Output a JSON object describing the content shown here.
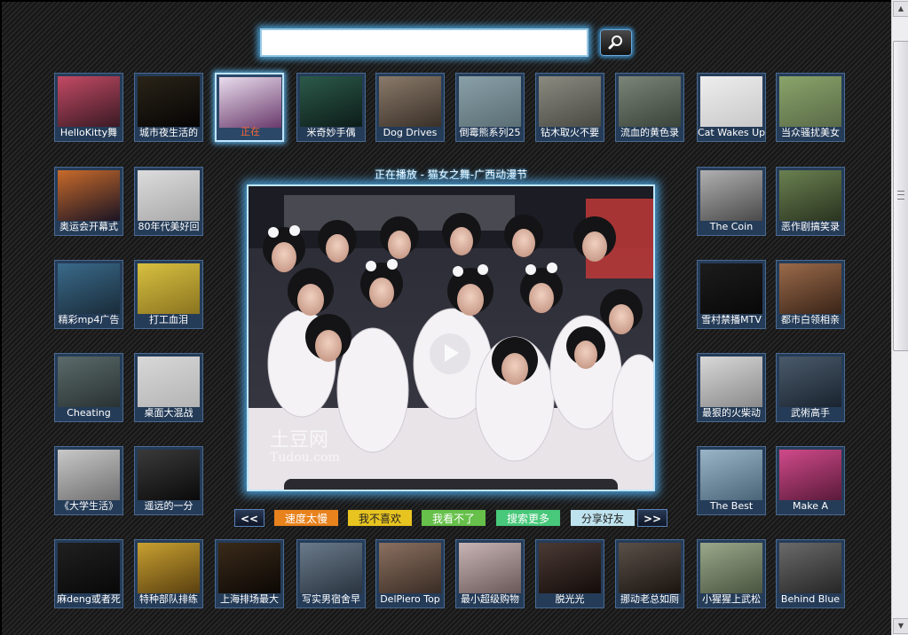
{
  "search": {
    "placeholder": "",
    "value": "",
    "button_icon": "magnifier-icon"
  },
  "player": {
    "now_playing": "正在播放 - 猫女之舞-广西动漫节",
    "watermark_line1": "土豆网",
    "watermark_line2": "Tudou.com"
  },
  "controls": {
    "prev": "<<",
    "next": ">>",
    "buttons": [
      {
        "label": "速度太慢",
        "bg": "#e8821c",
        "fg": "#ffffff"
      },
      {
        "label": "我不喜欢",
        "bg": "#e8c420",
        "fg": "#222222"
      },
      {
        "label": "我看不了",
        "bg": "#66c04a",
        "fg": "#ffffff"
      },
      {
        "label": "搜索更多",
        "bg": "#48c87a",
        "fg": "#ffffff"
      },
      {
        "label": "分享好友",
        "bg": "#bfe3ee",
        "fg": "#222222"
      }
    ]
  },
  "videos": {
    "top": [
      {
        "caption": "HelloKitty舞",
        "colors": [
          "#c24a64",
          "#3a1a24"
        ]
      },
      {
        "caption": "城市夜生活的",
        "colors": [
          "#2a2418",
          "#060404"
        ]
      },
      {
        "caption": "正在",
        "colors": [
          "#e8dcec",
          "#6a3a6c"
        ],
        "active": true
      },
      {
        "caption": "米奇妙手偶",
        "colors": [
          "#2c5a4a",
          "#0c1c18"
        ]
      },
      {
        "caption": "Dog Drives",
        "colors": [
          "#8a7a6a",
          "#3a3028"
        ]
      },
      {
        "caption": "倒霉熊系列25",
        "colors": [
          "#8aa0a8",
          "#5a6e74"
        ]
      },
      {
        "caption": "钻木取火不要",
        "colors": [
          "#8a8a80",
          "#4a4a44"
        ]
      },
      {
        "caption": "流血的黄色录",
        "colors": [
          "#7a8478",
          "#3a443a"
        ]
      },
      {
        "caption": "Cat Wakes Up",
        "colors": [
          "#eeeeee",
          "#c8c8c8"
        ]
      },
      {
        "caption": "当众骚扰美女",
        "colors": [
          "#8aa46a",
          "#5a6a48"
        ]
      }
    ],
    "left": [
      {
        "caption": "奥运会开幕式",
        "colors": [
          "#c86a2a",
          "#1a1424"
        ]
      },
      {
        "caption": "80年代美好回",
        "colors": [
          "#dcdcdc",
          "#a8a8a8"
        ]
      },
      {
        "caption": "精彩mp4广告",
        "colors": [
          "#3a6a8a",
          "#1a2c3a"
        ]
      },
      {
        "caption": "打工血泪",
        "colors": [
          "#d8c040",
          "#8a7420"
        ]
      },
      {
        "caption": "Cheating",
        "colors": [
          "#5a6a6a",
          "#2a3232"
        ]
      },
      {
        "caption": "桌面大混战",
        "colors": [
          "#d8d8d8",
          "#b4b4b4"
        ]
      },
      {
        "caption": "《大学生活》",
        "colors": [
          "#c8c8c8",
          "#707070"
        ]
      },
      {
        "caption": "遥远的一分",
        "colors": [
          "#3a3a3a",
          "#0a0a0a"
        ]
      }
    ],
    "right": [
      {
        "caption": "The Coin",
        "colors": [
          "#b0b0b0",
          "#4a4a4a"
        ]
      },
      {
        "caption": "恶作剧搞笑录",
        "colors": [
          "#6a8050",
          "#2a3420"
        ]
      },
      {
        "caption": "雪村禁播MTV",
        "colors": [
          "#1c1c1c",
          "#080808"
        ]
      },
      {
        "caption": "都市白领相亲",
        "colors": [
          "#9a6a4a",
          "#3a2418"
        ]
      },
      {
        "caption": "最狠的火柴动",
        "colors": [
          "#d8d8d8",
          "#8a8a8a"
        ]
      },
      {
        "caption": "武術高手",
        "colors": [
          "#4a5a6a",
          "#1a2430"
        ]
      },
      {
        "caption": "The Best",
        "colors": [
          "#9ab4c8",
          "#4a6478"
        ]
      },
      {
        "caption": "Make A",
        "colors": [
          "#d04a8a",
          "#5a1a3a"
        ]
      }
    ],
    "bottom": [
      {
        "caption": "麻deng或者死",
        "colors": [
          "#202020",
          "#080808"
        ]
      },
      {
        "caption": "特种部队排练",
        "colors": [
          "#c8a030",
          "#5a4010"
        ]
      },
      {
        "caption": "上海排场最大",
        "colors": [
          "#3a2a1a",
          "#0c0804"
        ]
      },
      {
        "caption": "写实男宿舍早",
        "colors": [
          "#6a7a8a",
          "#2a3440"
        ]
      },
      {
        "caption": "DelPiero Top",
        "colors": [
          "#8a7060",
          "#3a2c24"
        ]
      },
      {
        "caption": "最小超级购物",
        "colors": [
          "#c8b4b4",
          "#6a5858"
        ]
      },
      {
        "caption": "脱光光",
        "colors": [
          "#4a3a34",
          "#140c0a"
        ]
      },
      {
        "caption": "挪动老总如厕",
        "colors": [
          "#5a5048",
          "#1a1410"
        ]
      },
      {
        "caption": "小猩猩上武松",
        "colors": [
          "#9aa88a",
          "#4a5440"
        ]
      },
      {
        "caption": "Behind Blue",
        "colors": [
          "#6a6a6a",
          "#262626"
        ]
      }
    ]
  }
}
